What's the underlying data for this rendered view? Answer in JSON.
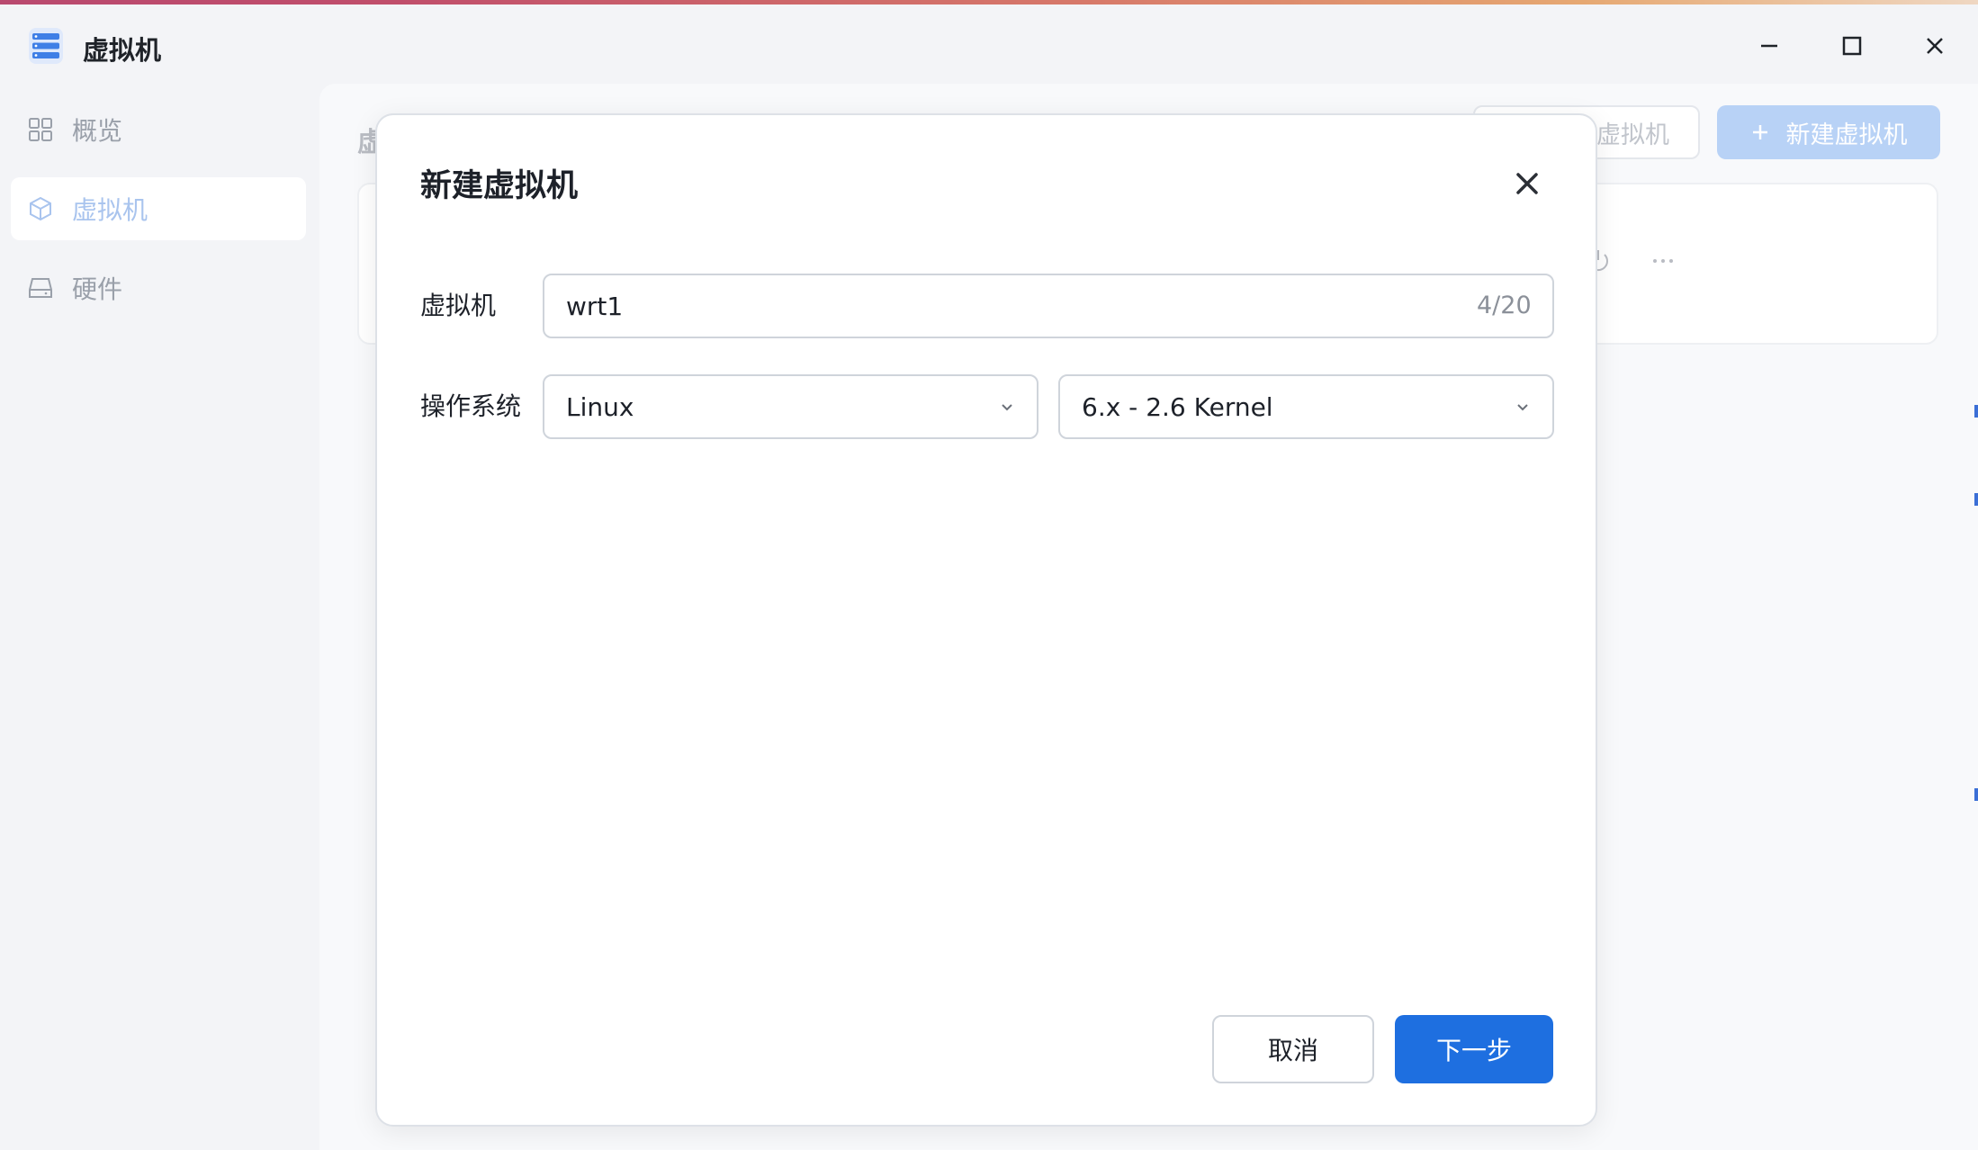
{
  "window": {
    "title": "虚拟机",
    "controls": [
      "minimize-icon",
      "maximize-icon",
      "close-icon"
    ]
  },
  "sidebar": {
    "items": [
      {
        "label": "概览",
        "icon": "grid-icon",
        "active": false
      },
      {
        "label": "虚拟机",
        "icon": "cube-icon",
        "active": true
      },
      {
        "label": "硬件",
        "icon": "drive-icon",
        "active": false
      }
    ]
  },
  "background": {
    "page_title": "虚",
    "ghost_button_label": "虚拟机",
    "new_vm_button_label": "新建虚拟机",
    "card_actions": [
      "monitor-icon",
      "power-icon",
      "more-icon"
    ]
  },
  "dialog": {
    "title": "新建虚拟机",
    "name_label": "虚拟机",
    "name_value": "wrt1",
    "name_counter": "4/20",
    "os_label": "操作系统",
    "os_type": "Linux",
    "os_version": "6.x - 2.6 Kernel",
    "cancel_label": "取消",
    "next_label": "下一步"
  },
  "colors": {
    "primary": "#1e6fe0",
    "primary_disabled": "#b8d2f6",
    "sidebar_active_text": "#a9c4ee",
    "border": "#cfd4db",
    "window_bg": "#f3f4f7"
  }
}
